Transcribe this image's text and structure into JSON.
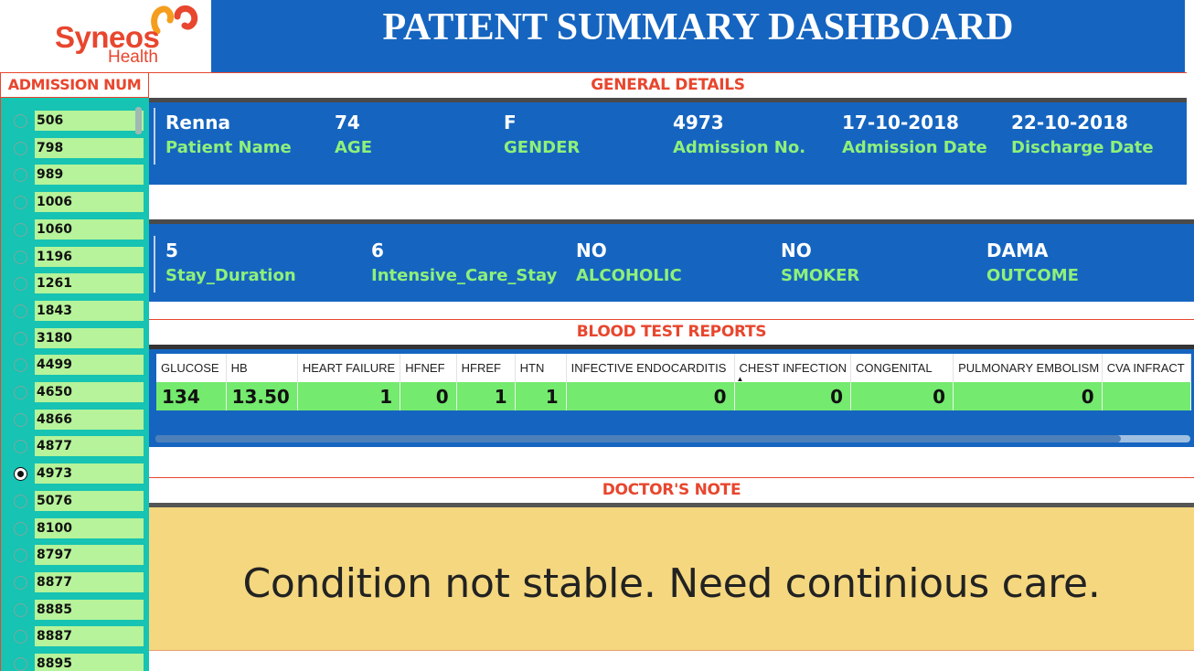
{
  "logo": {
    "brand": "Syneos",
    "sub": "Health"
  },
  "title": "PATIENT SUMMARY DASHBOARD",
  "slicer": {
    "header": "ADMISSION NUM",
    "selected": "4973",
    "items": [
      "506",
      "798",
      "989",
      "1006",
      "1060",
      "1196",
      "1261",
      "1843",
      "3180",
      "4499",
      "4650",
      "4866",
      "4877",
      "4973",
      "5076",
      "8100",
      "8797",
      "8877",
      "8885",
      "8887",
      "8895"
    ]
  },
  "general": {
    "header": "GENERAL DETAILS",
    "fields": [
      {
        "value": "Renna",
        "label": "Patient Name"
      },
      {
        "value": "74",
        "label": "AGE"
      },
      {
        "value": "F",
        "label": "GENDER"
      },
      {
        "value": "4973",
        "label": "Admission No."
      },
      {
        "value": "17-10-2018",
        "label": "Admission Date"
      },
      {
        "value": "22-10-2018",
        "label": "Discharge Date"
      }
    ]
  },
  "stay": {
    "fields": [
      {
        "value": "5",
        "label": "Stay_Duration"
      },
      {
        "value": "6",
        "label": "Intensive_Care_Stay"
      },
      {
        "value": "NO",
        "label": "ALCOHOLIC"
      },
      {
        "value": "NO",
        "label": "SMOKER"
      },
      {
        "value": "DAMA",
        "label": "OUTCOME"
      }
    ]
  },
  "blood": {
    "header": "BLOOD TEST REPORTS",
    "columns": [
      "GLUCOSE",
      "HB",
      "HEART FAILURE",
      "HFNEF",
      "HFREF",
      "HTN",
      "INFECTIVE ENDOCARDITIS",
      "CHEST INFECTION",
      "CONGENITAL",
      "PULMONARY EMBOLISM",
      "CVA INFRACT"
    ],
    "row": [
      "134",
      "13.50",
      "1",
      "0",
      "1",
      "1",
      "0",
      "0",
      "0",
      "0",
      ""
    ],
    "sorted_column": "CHEST INFECTION"
  },
  "note": {
    "header": "DOCTOR'S NOTE",
    "text": "Condition not stable. Need continious care."
  },
  "colors": {
    "accent": "#e8462e",
    "blue": "#1565c0",
    "green_label": "#8ff07a",
    "note_bg": "#f4d77f",
    "slicer_bg": "#17c3b2"
  }
}
